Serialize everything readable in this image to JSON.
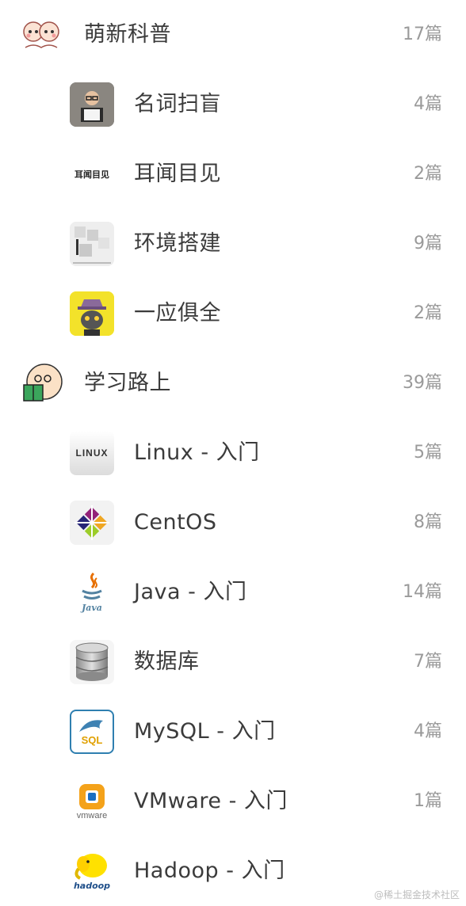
{
  "groups": [
    {
      "label": "萌新科普",
      "count": "17篇",
      "icon": "cartoon-couple-icon",
      "items": [
        {
          "label": "名词扫盲",
          "count": "4篇",
          "icon": "boy-reading-book-icon"
        },
        {
          "label": "耳闻目见",
          "count": "2篇",
          "icon": "calligraphy-text-icon",
          "icon_text": "耳闻目见"
        },
        {
          "label": "环境搭建",
          "count": "9篇",
          "icon": "puzzle-icon"
        },
        {
          "label": "一应俱全",
          "count": "2篇",
          "icon": "cat-with-hat-icon"
        }
      ]
    },
    {
      "label": "学习路上",
      "count": "39篇",
      "icon": "bald-man-reading-icon",
      "items": [
        {
          "label": "Linux - 入门",
          "count": "5篇",
          "icon": "linux-logo-icon",
          "icon_text": "LINUX"
        },
        {
          "label": "CentOS",
          "count": "8篇",
          "icon": "centos-logo-icon"
        },
        {
          "label": "Java - 入门",
          "count": "14篇",
          "icon": "java-logo-icon",
          "icon_text": "Java"
        },
        {
          "label": "数据库",
          "count": "7篇",
          "icon": "database-icon"
        },
        {
          "label": "MySQL - 入门",
          "count": "4篇",
          "icon": "mysql-logo-icon",
          "icon_text": "SQL"
        },
        {
          "label": "VMware - 入门",
          "count": "1篇",
          "icon": "vmware-logo-icon",
          "icon_text": "vmware"
        },
        {
          "label": "Hadoop - 入门",
          "count": "",
          "icon": "hadoop-elephant-icon",
          "icon_text": "hadoop"
        }
      ]
    }
  ],
  "watermark": "@稀土掘金技术社区"
}
